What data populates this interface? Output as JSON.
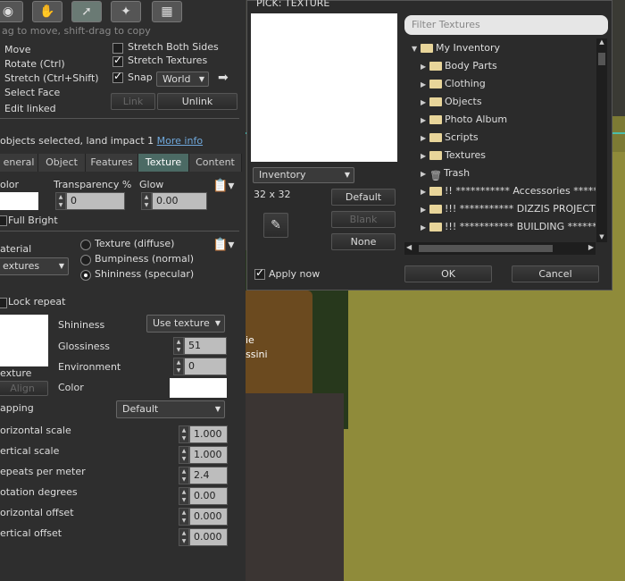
{
  "scene": {
    "text1": "ie",
    "text2": "ssini"
  },
  "build": {
    "hint": "ag to move, shift-drag to copy",
    "tools": [
      "focus-icon",
      "move-icon",
      "edit-icon",
      "create-icon",
      "land-icon"
    ],
    "modes": [
      "Move",
      "Rotate (Ctrl)",
      "Stretch (Ctrl+Shift)",
      "Select Face",
      "Edit linked"
    ],
    "stretch_both": "Stretch Both Sides",
    "stretch_textures": "Stretch Textures",
    "snap": "Snap",
    "snap_mode": "World",
    "link": "Link",
    "unlink": "Unlink",
    "selected_text": "objects selected, land impact 1",
    "more_info": "More info",
    "tabs": [
      "eneral",
      "Object",
      "Features",
      "Texture",
      "Content"
    ],
    "color_label": "olor",
    "transparency_label": "Transparency %",
    "transparency_value": "0",
    "glow_label": "Glow",
    "glow_value": "0.00",
    "full_bright": "Full Bright",
    "material_label": "aterial",
    "material_value": "extures",
    "mat_options": [
      "Texture (diffuse)",
      "Bumpiness (normal)",
      "Shininess (specular)"
    ],
    "lock_repeat": "Lock repeat",
    "texture_label": "exture",
    "align": "Align",
    "shininess_label": "Shininess",
    "shininess_value": "Use texture",
    "glossiness_label": "Glossiness",
    "glossiness_value": "51",
    "environment_label": "Environment",
    "environment_value": "0",
    "color2_label": "Color",
    "mapping_label": "apping",
    "mapping_value": "Default",
    "params": [
      {
        "label": "orizontal scale",
        "value": "1.000"
      },
      {
        "label": "ertical scale",
        "value": "1.000"
      },
      {
        "label": "epeats per meter",
        "value": "2.4"
      },
      {
        "label": "otation degrees",
        "value": "0.00"
      },
      {
        "label": "orizontal offset",
        "value": "0.000"
      },
      {
        "label": "ertical offset",
        "value": "0.000"
      }
    ]
  },
  "picker": {
    "title": "PICK: TEXTURE",
    "filter_placeholder": "Filter Textures",
    "source": "Inventory",
    "size": "32 x 32",
    "default": "Default",
    "blank": "Blank",
    "none": "None",
    "apply_now": "Apply now",
    "ok": "OK",
    "cancel": "Cancel",
    "tree": [
      {
        "label": "My Inventory",
        "indent": 0,
        "open": true
      },
      {
        "label": "Body Parts",
        "indent": 1
      },
      {
        "label": "Clothing",
        "indent": 1
      },
      {
        "label": "Objects",
        "indent": 1
      },
      {
        "label": "Photo Album",
        "indent": 1
      },
      {
        "label": "Scripts",
        "indent": 1
      },
      {
        "label": "Textures",
        "indent": 1
      },
      {
        "label": "Trash",
        "indent": 1,
        "trash": true
      },
      {
        "label": "!!    *********** Accessories *****",
        "indent": 1
      },
      {
        "label": "!!!    *********** DIZZIS PROJECTS",
        "indent": 1
      },
      {
        "label": "!!!    *********** BUILDING *******",
        "indent": 1
      }
    ]
  }
}
